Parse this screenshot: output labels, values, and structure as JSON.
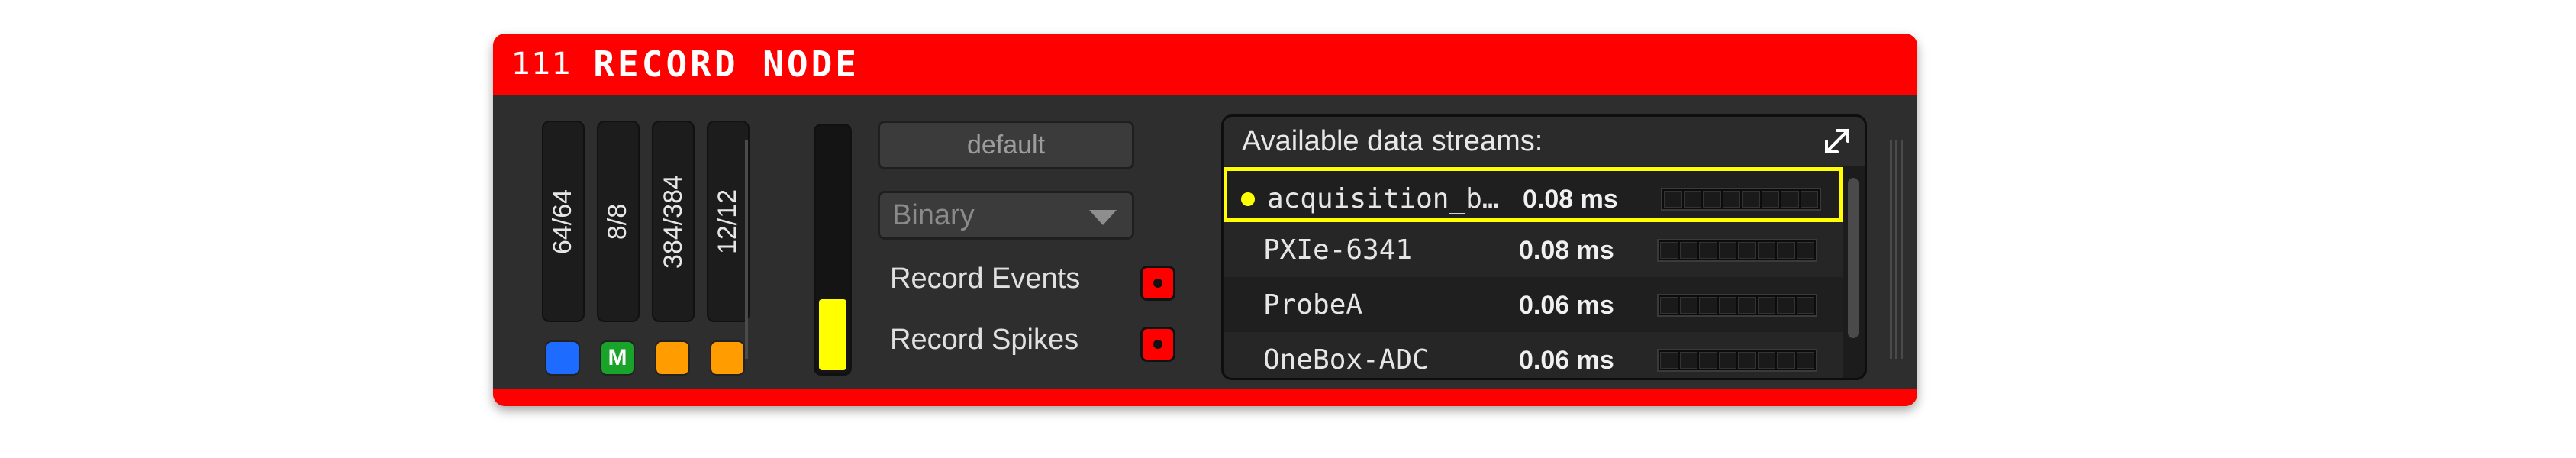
{
  "node": {
    "id": "111",
    "title": "RECORD NODE"
  },
  "channel_meters": [
    {
      "label": "64/64"
    },
    {
      "label": "8/8"
    },
    {
      "label": "384/384"
    },
    {
      "label": "12/12"
    }
  ],
  "stream_buttons": [
    {
      "label": "",
      "color": "#1e6cff"
    },
    {
      "label": "M",
      "color": "#1aa32a"
    },
    {
      "label": "",
      "color": "#ff9c00"
    },
    {
      "label": "",
      "color": "#ff9c00"
    }
  ],
  "level_meter": {
    "fraction": 0.3,
    "color": "#ffff00"
  },
  "directory_button": {
    "label": "default"
  },
  "engine_select": {
    "value": "Binary"
  },
  "record_options": {
    "events_label": "Record Events",
    "spikes_label": "Record Spikes"
  },
  "streams_panel": {
    "header": "Available data streams:",
    "rows": [
      {
        "name": "acquisition_b…",
        "latency": "0.08 ms",
        "selected": true
      },
      {
        "name": "PXIe-6341",
        "latency": "0.08 ms",
        "selected": false
      },
      {
        "name": "ProbeA",
        "latency": "0.06 ms",
        "selected": false
      },
      {
        "name": "OneBox-ADC",
        "latency": "0.06 ms",
        "selected": false
      }
    ]
  },
  "colors": {
    "accent_red": "#ff0000",
    "panel_bg": "#2e2e2e",
    "highlight_yellow": "#ffff00"
  }
}
